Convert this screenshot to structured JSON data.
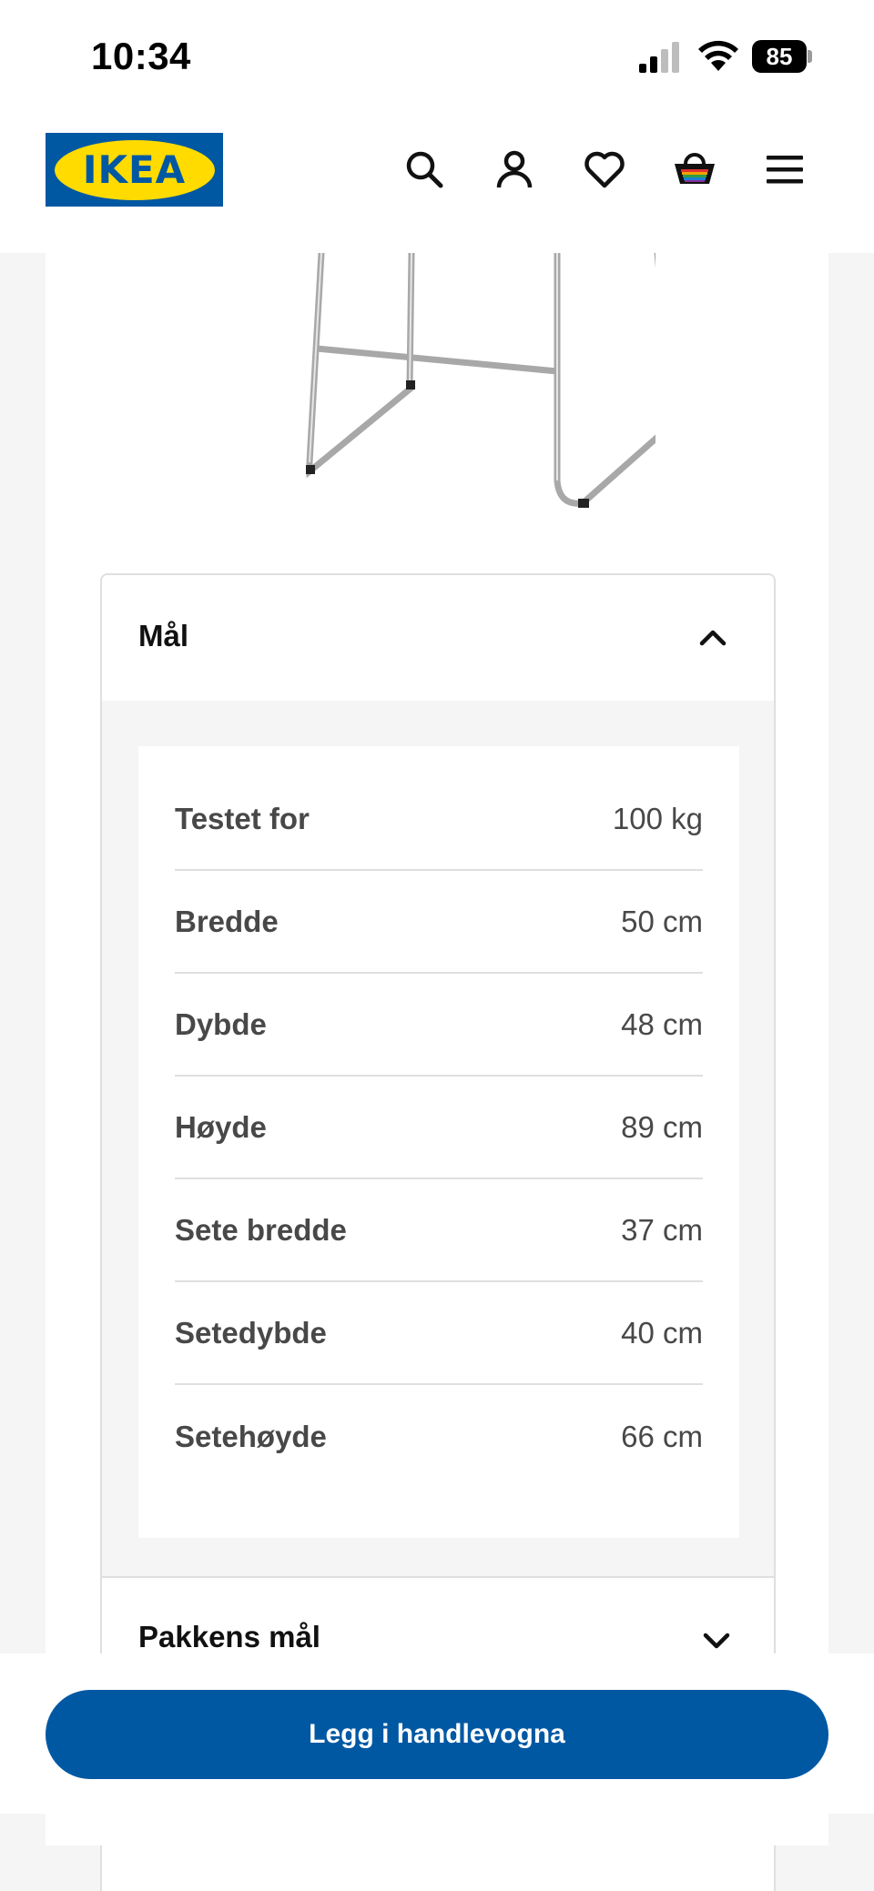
{
  "status_bar": {
    "time": "10:34",
    "battery": "85"
  },
  "header": {
    "logo_text": "IKEA",
    "icons": [
      "search-icon",
      "account-icon",
      "heart-icon",
      "basket-icon",
      "menu-icon"
    ]
  },
  "colors": {
    "brand_blue": "#0058a3",
    "brand_yellow": "#ffdb00",
    "background": "#f5f5f5"
  },
  "dimensions_section": {
    "title": "Mål",
    "expanded": true,
    "rows": [
      {
        "label": "Testet for",
        "value": "100 kg"
      },
      {
        "label": "Bredde",
        "value": "50 cm"
      },
      {
        "label": "Dybde",
        "value": "48 cm"
      },
      {
        "label": "Høyde",
        "value": "89 cm"
      },
      {
        "label": "Sete bredde",
        "value": "37 cm"
      },
      {
        "label": "Setedybde",
        "value": "40 cm"
      },
      {
        "label": "Setehøyde",
        "value": "66 cm"
      }
    ]
  },
  "package_section": {
    "title": "Pakkens mål",
    "expanded": false
  },
  "cta": {
    "label": "Legg i handlevogna"
  }
}
